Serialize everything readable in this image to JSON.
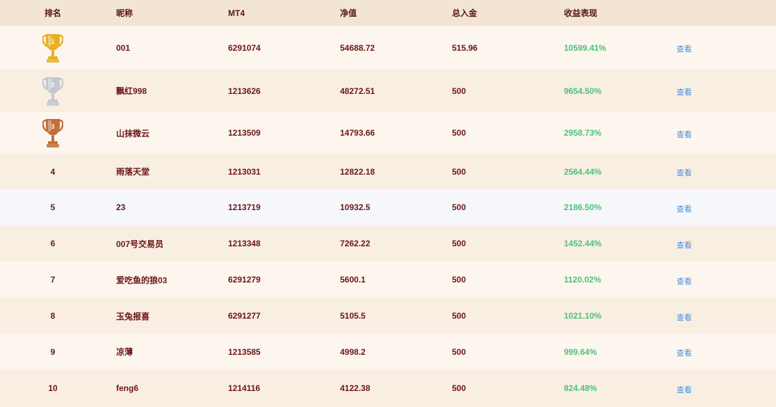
{
  "header": {
    "rank": "排名",
    "nickname": "昵称",
    "mt4": "MT4",
    "equity": "净值",
    "deposit": "总入金",
    "return": "收益表现"
  },
  "rows": [
    {
      "rank": "1",
      "name": "001",
      "mt4": "6291074",
      "equity": "54688.72",
      "deposit": "515.96",
      "return": "10599.41%",
      "action": "查看",
      "trophy": "gold-trophy-icon"
    },
    {
      "rank": "2",
      "name": "飘红998",
      "mt4": "1213626",
      "equity": "48272.51",
      "deposit": "500",
      "return": "9654.50%",
      "action": "查看",
      "trophy": "silver-trophy-icon"
    },
    {
      "rank": "3",
      "name": "山抹微云",
      "mt4": "1213509",
      "equity": "14793.66",
      "deposit": "500",
      "return": "2958.73%",
      "action": "查看",
      "trophy": "bronze-trophy-icon"
    },
    {
      "rank": "4",
      "name": "雨落天堂",
      "mt4": "1213031",
      "equity": "12822.18",
      "deposit": "500",
      "return": "2564.44%",
      "action": "查看"
    },
    {
      "rank": "5",
      "name": "23",
      "mt4": "1213719",
      "equity": "10932.5",
      "deposit": "500",
      "return": "2186.50%",
      "action": "查看"
    },
    {
      "rank": "6",
      "name": "007号交易员",
      "mt4": "1213348",
      "equity": "7262.22",
      "deposit": "500",
      "return": "1452.44%",
      "action": "查看"
    },
    {
      "rank": "7",
      "name": "爱吃鱼的狼03",
      "mt4": "6291279",
      "equity": "5600.1",
      "deposit": "500",
      "return": "1120.02%",
      "action": "查看"
    },
    {
      "rank": "8",
      "name": "玉兔报喜",
      "mt4": "6291277",
      "equity": "5105.5",
      "deposit": "500",
      "return": "1021.10%",
      "action": "查看"
    },
    {
      "rank": "9",
      "name": "凉薄",
      "mt4": "1213585",
      "equity": "4998.2",
      "deposit": "500",
      "return": "999.64%",
      "action": "查看"
    },
    {
      "rank": "10",
      "name": "feng6",
      "mt4": "1214116",
      "equity": "4122.38",
      "deposit": "500",
      "return": "824.48%",
      "action": "查看"
    }
  ],
  "colors": {
    "header_bg": "#f3e5d3",
    "row_light": "#fdf6ee",
    "row_dark": "#f9eee2",
    "row_highlight": "#f5f7fb",
    "text": "#6b1616",
    "return_green": "#4fc07a",
    "link_blue": "#4a90d8",
    "gold": "#e8b022",
    "silver": "#c2c8d0",
    "bronze": "#c0703a"
  }
}
